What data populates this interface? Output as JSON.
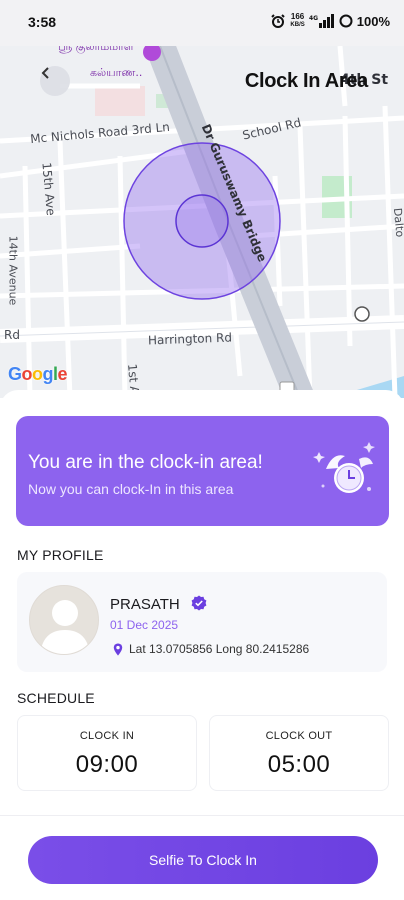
{
  "status_bar": {
    "time": "3:58",
    "network_top": "166",
    "network_bottom": "KB/S",
    "battery": "100%"
  },
  "header": {
    "title": "Clock In Area",
    "back_icon": "chevron-left-icon"
  },
  "map": {
    "labels": {
      "tamil_line1": "ஸ்ரீ குலாம்மாள்",
      "tamil_line2": "கல்யாண..",
      "fourth_st": "4th St",
      "mc_nichols": "Mc Nichols Road 3rd Ln",
      "school_rd": "School Rd",
      "bridge": "Dr Guruswamy Bridge",
      "fifteenth_ave": "15th Ave",
      "fourteenth_ave": "14th Avenue",
      "harrington": "Harrington Rd",
      "rd_left": "Rd",
      "first_st": "1st A",
      "dalton": "Dalto"
    },
    "logo": "Google",
    "logo_colors": [
      "#4285F4",
      "#EA4335",
      "#FBBC05",
      "#4285F4",
      "#34A853",
      "#EA4335"
    ],
    "geofence_color": "#8d63ee"
  },
  "banner": {
    "title": "You are in the clock-in area!",
    "subtitle": "Now you can clock-In in this area"
  },
  "profile": {
    "section_title": "MY PROFILE",
    "name": "PRASATH",
    "date": "01 Dec 2025",
    "location": "Lat 13.0705856 Long 80.2415286"
  },
  "schedule": {
    "section_title": "SCHEDULE",
    "clock_in_label": "CLOCK IN",
    "clock_in_time": "09:00",
    "clock_out_label": "CLOCK OUT",
    "clock_out_time": "05:00"
  },
  "cta": {
    "label": "Selfie To Clock In"
  },
  "colors": {
    "accent": "#8d63ee",
    "button": "#6e42e3"
  }
}
